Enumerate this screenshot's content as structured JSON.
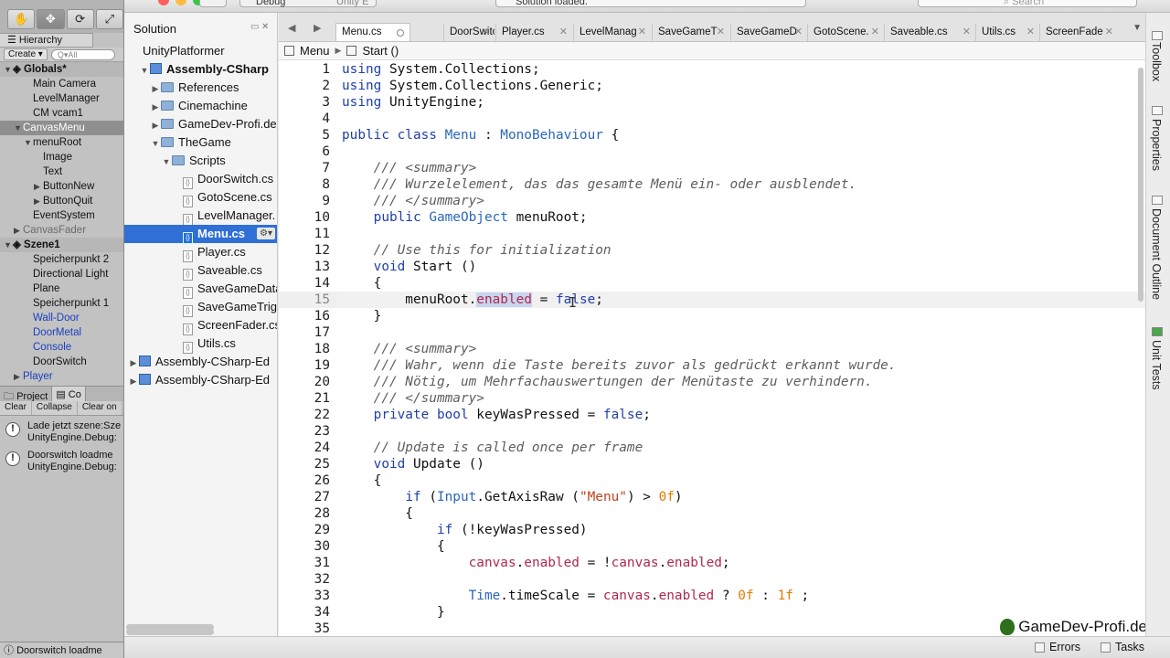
{
  "unity": {
    "hierarchy_tab": "Hierarchy",
    "create_label": "Create",
    "search_placeholder": "Q▾All",
    "rows": [
      {
        "label": "Globals*",
        "indent": 0,
        "tri": "▼",
        "style": "scene",
        "icon": "unity-scene-icon"
      },
      {
        "label": "Main Camera",
        "indent": 2,
        "tri": "",
        "style": ""
      },
      {
        "label": "LevelManager",
        "indent": 2,
        "tri": "",
        "style": ""
      },
      {
        "label": "CM vcam1",
        "indent": 2,
        "tri": "",
        "style": ""
      },
      {
        "label": "CanvasMenu",
        "indent": 1,
        "tri": "▼",
        "style": "sel"
      },
      {
        "label": "menuRoot",
        "indent": 2,
        "tri": "▼",
        "style": ""
      },
      {
        "label": "Image",
        "indent": 3,
        "tri": "",
        "style": ""
      },
      {
        "label": "Text",
        "indent": 3,
        "tri": "",
        "style": ""
      },
      {
        "label": "ButtonNew",
        "indent": 3,
        "tri": "▶",
        "style": ""
      },
      {
        "label": "ButtonQuit",
        "indent": 3,
        "tri": "▶",
        "style": ""
      },
      {
        "label": "EventSystem",
        "indent": 2,
        "tri": "",
        "style": ""
      },
      {
        "label": "CanvasFader",
        "indent": 1,
        "tri": "▶",
        "style": "gray"
      },
      {
        "label": "Szene1",
        "indent": 0,
        "tri": "▼",
        "style": "scene",
        "icon": "unity-scene-icon"
      },
      {
        "label": "Speicherpunkt 2",
        "indent": 2,
        "tri": "",
        "style": ""
      },
      {
        "label": "Directional Light",
        "indent": 2,
        "tri": "",
        "style": ""
      },
      {
        "label": "Plane",
        "indent": 2,
        "tri": "",
        "style": ""
      },
      {
        "label": "Speicherpunkt 1",
        "indent": 2,
        "tri": "",
        "style": ""
      },
      {
        "label": "Wall-Door",
        "indent": 2,
        "tri": "",
        "style": "blue"
      },
      {
        "label": "DoorMetal",
        "indent": 2,
        "tri": "",
        "style": "blue"
      },
      {
        "label": "Console",
        "indent": 2,
        "tri": "",
        "style": "blue"
      },
      {
        "label": "DoorSwitch",
        "indent": 2,
        "tri": "",
        "style": ""
      },
      {
        "label": "Player",
        "indent": 1,
        "tri": "▶",
        "style": "blue"
      }
    ],
    "project_tab": "Project",
    "console_tab": "Co",
    "console_buttons": [
      "Clear",
      "Collapse",
      "Clear on"
    ],
    "logs": [
      {
        "line1": "Lade jetzt szene:Sze",
        "line2": "UnityEngine.Debug:"
      },
      {
        "line1": "Doorswitch loadme",
        "line2": "UnityEngine.Debug:"
      }
    ],
    "status": "Doorswitch loadme"
  },
  "titlebar": {
    "config": "Debug",
    "target": "Unity E",
    "status": "Solution loaded.",
    "search_placeholder": "Search"
  },
  "solution": {
    "title": "Solution",
    "rows": [
      {
        "label": "UnityPlatformer",
        "indent": 0,
        "arrow": "",
        "icon": "solution",
        "bold": false
      },
      {
        "label": "Assembly-CSharp",
        "indent": 1,
        "arrow": "▼",
        "icon": "project",
        "bold": true
      },
      {
        "label": "References",
        "indent": 2,
        "arrow": "▶",
        "icon": "folder",
        "bold": false
      },
      {
        "label": "Cinemachine",
        "indent": 2,
        "arrow": "▶",
        "icon": "folder",
        "bold": false
      },
      {
        "label": "GameDev-Profi.de",
        "indent": 2,
        "arrow": "▶",
        "icon": "folder",
        "bold": false
      },
      {
        "label": "TheGame",
        "indent": 2,
        "arrow": "▼",
        "icon": "folder",
        "bold": false
      },
      {
        "label": "Scripts",
        "indent": 3,
        "arrow": "▼",
        "icon": "folder",
        "bold": false
      },
      {
        "label": "DoorSwitch.cs",
        "indent": 4,
        "arrow": "",
        "icon": "cs",
        "bold": false
      },
      {
        "label": "GotoScene.cs",
        "indent": 4,
        "arrow": "",
        "icon": "cs",
        "bold": false
      },
      {
        "label": "LevelManager.",
        "indent": 4,
        "arrow": "",
        "icon": "cs",
        "bold": false
      },
      {
        "label": "Menu.cs",
        "indent": 4,
        "arrow": "",
        "icon": "cs",
        "bold": true,
        "selected": true
      },
      {
        "label": "Player.cs",
        "indent": 4,
        "arrow": "",
        "icon": "cs",
        "bold": false
      },
      {
        "label": "Saveable.cs",
        "indent": 4,
        "arrow": "",
        "icon": "cs",
        "bold": false
      },
      {
        "label": "SaveGameData",
        "indent": 4,
        "arrow": "",
        "icon": "cs",
        "bold": false
      },
      {
        "label": "SaveGameTrig",
        "indent": 4,
        "arrow": "",
        "icon": "cs",
        "bold": false
      },
      {
        "label": "ScreenFader.cs",
        "indent": 4,
        "arrow": "",
        "icon": "cs",
        "bold": false
      },
      {
        "label": "Utils.cs",
        "indent": 4,
        "arrow": "",
        "icon": "cs",
        "bold": false
      },
      {
        "label": "Assembly-CSharp-Ed",
        "indent": 0,
        "arrow": "▶",
        "icon": "project",
        "bold": false
      },
      {
        "label": "Assembly-CSharp-Ed",
        "indent": 0,
        "arrow": "▶",
        "icon": "project",
        "bold": false
      }
    ]
  },
  "editor": {
    "tabs": [
      "Menu.cs",
      "DoorSwitch",
      "Player.cs",
      "LevelManag",
      "SaveGameT",
      "SaveGameD",
      "GotoScene.",
      "Saveable.cs",
      "Utils.cs",
      "ScreenFade"
    ],
    "breadcrumb": {
      "class": "Menu",
      "method": "Start ()"
    },
    "current_line": 15,
    "lines": [
      [
        [
          "k",
          "using"
        ],
        [
          "p",
          " System.Collections;"
        ]
      ],
      [
        [
          "k",
          "using"
        ],
        [
          "p",
          " System.Collections.Generic;"
        ]
      ],
      [
        [
          "k",
          "using"
        ],
        [
          "p",
          " UnityEngine;"
        ]
      ],
      [],
      [
        [
          "k",
          "public class "
        ],
        [
          "t",
          "Menu"
        ],
        [
          "p",
          " : "
        ],
        [
          "t",
          "MonoBehaviour"
        ],
        [
          "p",
          " {"
        ]
      ],
      [],
      [
        [
          "p",
          "    "
        ],
        [
          "c",
          "/// <summary>"
        ]
      ],
      [
        [
          "p",
          "    "
        ],
        [
          "c",
          "/// Wurzelelement, das das gesamte Menü ein- oder ausblendet."
        ]
      ],
      [
        [
          "p",
          "    "
        ],
        [
          "c",
          "/// </summary>"
        ]
      ],
      [
        [
          "p",
          "    "
        ],
        [
          "k",
          "public "
        ],
        [
          "t",
          "GameObject"
        ],
        [
          "p",
          " menuRoot;"
        ]
      ],
      [],
      [
        [
          "p",
          "    "
        ],
        [
          "c",
          "// Use this for initialization"
        ]
      ],
      [
        [
          "p",
          "    "
        ],
        [
          "k",
          "void "
        ],
        [
          "p",
          "Start ()"
        ]
      ],
      [
        [
          "p",
          "    {"
        ]
      ],
      [
        [
          "p",
          "        menuRoot."
        ],
        [
          "hl",
          "enabled"
        ],
        [
          "p",
          " = "
        ],
        [
          "k",
          "false"
        ],
        [
          "p",
          ";"
        ]
      ],
      [
        [
          "p",
          "    }"
        ]
      ],
      [],
      [
        [
          "p",
          "    "
        ],
        [
          "c",
          "/// <summary>"
        ]
      ],
      [
        [
          "p",
          "    "
        ],
        [
          "c",
          "/// Wahr, wenn die Taste bereits zuvor als gedrückt erkannt wurde."
        ]
      ],
      [
        [
          "p",
          "    "
        ],
        [
          "c",
          "/// Nötig, um Mehrfachauswertungen der Menütaste zu verhindern."
        ]
      ],
      [
        [
          "p",
          "    "
        ],
        [
          "c",
          "/// </summary>"
        ]
      ],
      [
        [
          "p",
          "    "
        ],
        [
          "k",
          "private bool "
        ],
        [
          "p",
          "keyWasPressed = "
        ],
        [
          "k",
          "false"
        ],
        [
          "p",
          ";"
        ]
      ],
      [],
      [
        [
          "p",
          "    "
        ],
        [
          "c",
          "// Update is called once per frame"
        ]
      ],
      [
        [
          "p",
          "    "
        ],
        [
          "k",
          "void "
        ],
        [
          "p",
          "Update ()"
        ]
      ],
      [
        [
          "p",
          "    {"
        ]
      ],
      [
        [
          "p",
          "        "
        ],
        [
          "k",
          "if "
        ],
        [
          "p",
          "("
        ],
        [
          "t",
          "Input"
        ],
        [
          "p",
          ".GetAxisRaw ("
        ],
        [
          "s",
          "\"Menu\""
        ],
        [
          "p",
          ") > "
        ],
        [
          "n",
          "0f"
        ],
        [
          "p",
          ")"
        ]
      ],
      [
        [
          "p",
          "        {"
        ]
      ],
      [
        [
          "p",
          "            "
        ],
        [
          "k",
          "if "
        ],
        [
          "p",
          "(!keyWasPressed)"
        ]
      ],
      [
        [
          "p",
          "            {"
        ]
      ],
      [
        [
          "p",
          "                "
        ],
        [
          "m",
          "canvas"
        ],
        [
          "p",
          "."
        ],
        [
          "m",
          "enabled"
        ],
        [
          "p",
          " = !"
        ],
        [
          "m",
          "canvas"
        ],
        [
          "p",
          "."
        ],
        [
          "m",
          "enabled"
        ],
        [
          "p",
          ";"
        ]
      ],
      [],
      [
        [
          "p",
          "                "
        ],
        [
          "t",
          "Time"
        ],
        [
          "p",
          ".timeScale = "
        ],
        [
          "m",
          "canvas"
        ],
        [
          "p",
          "."
        ],
        [
          "m",
          "enabled"
        ],
        [
          "p",
          " ? "
        ],
        [
          "n",
          "0f"
        ],
        [
          "p",
          " : "
        ],
        [
          "n",
          "1f"
        ],
        [
          "p",
          " ;"
        ]
      ],
      [
        [
          "p",
          "            }"
        ]
      ],
      []
    ],
    "watermark": "GameDev-Profi.de"
  },
  "right_pads": [
    "Toolbox",
    "Properties",
    "Document Outline",
    "Unit Tests"
  ],
  "statusbar": {
    "errors": "Errors",
    "tasks": "Tasks"
  }
}
